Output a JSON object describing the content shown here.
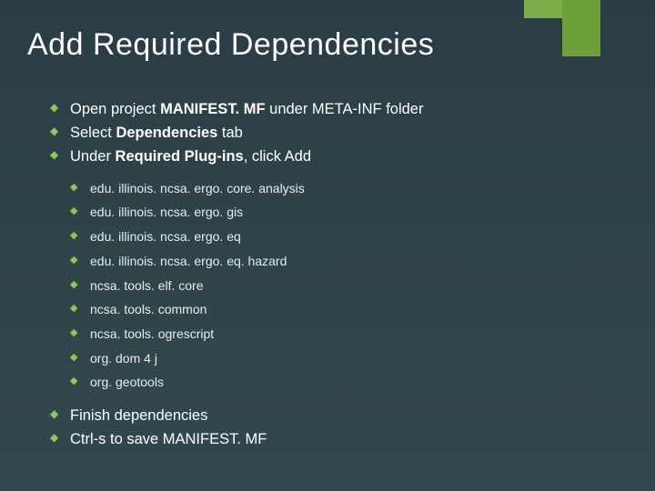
{
  "title": "Add Required Dependencies",
  "bullets": [
    {
      "prefix": "Open project ",
      "bold": "MANIFEST. MF ",
      "suffix": "under META-INF folder"
    },
    {
      "prefix": "Select ",
      "bold": "Dependencies ",
      "suffix": "tab"
    },
    {
      "prefix": "Under ",
      "bold": "Required Plug-ins",
      "suffix": ", click Add"
    },
    {
      "prefix": "Finish dependencies",
      "bold": "",
      "suffix": ""
    },
    {
      "prefix": "Ctrl-s to save MANIFEST. MF",
      "bold": "",
      "suffix": ""
    }
  ],
  "sub_bullets": [
    "edu. illinois. ncsa. ergo. core. analysis",
    "edu. illinois. ncsa. ergo. gis",
    "edu. illinois. ncsa. ergo. eq",
    "edu. illinois. ncsa. ergo. eq. hazard",
    "ncsa. tools. elf. core",
    "ncsa. tools. common",
    "ncsa. tools. ogrescript",
    "org. dom 4 j",
    "org. geotools"
  ]
}
